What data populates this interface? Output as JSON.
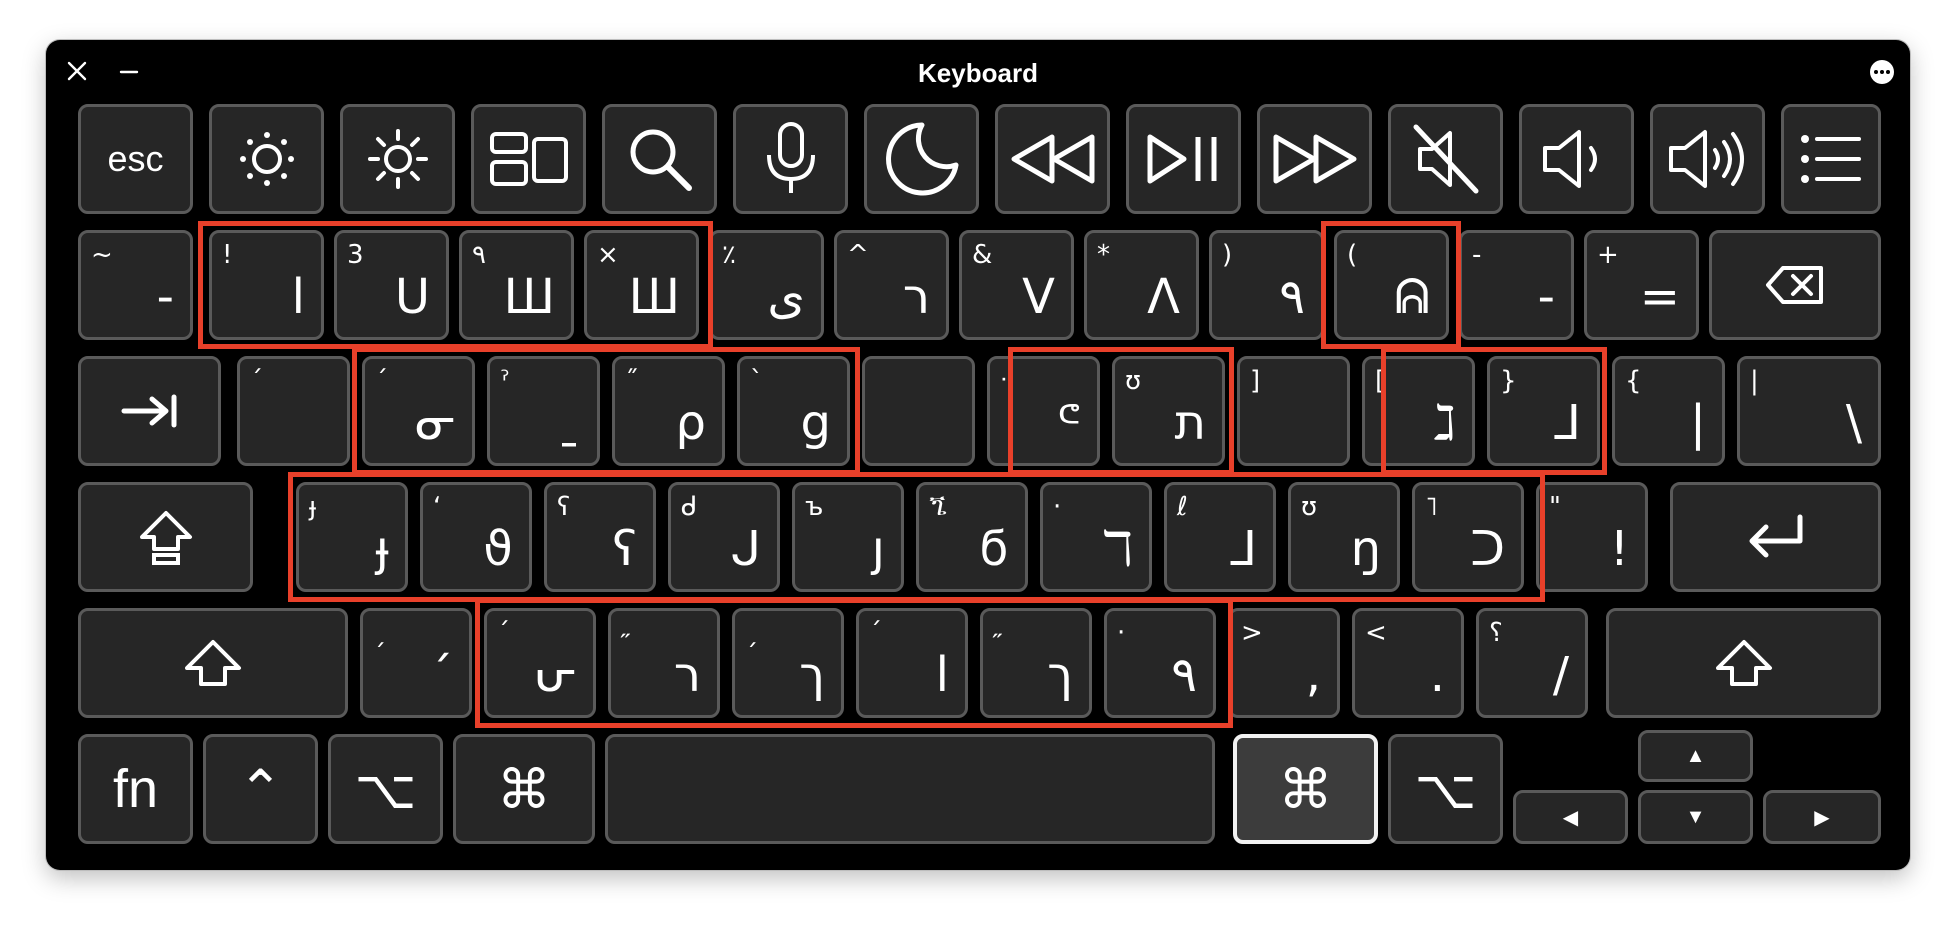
{
  "window": {
    "title": "Keyboard"
  },
  "function_row": [
    {
      "name": "esc-key",
      "label": "esc"
    },
    {
      "name": "brightness-down-key",
      "icon": "brightness-down-icon"
    },
    {
      "name": "brightness-up-key",
      "icon": "brightness-up-icon"
    },
    {
      "name": "mission-control-key",
      "icon": "mission-control-icon"
    },
    {
      "name": "spotlight-key",
      "icon": "search-icon"
    },
    {
      "name": "dictation-key",
      "icon": "microphone-icon"
    },
    {
      "name": "do-not-disturb-key",
      "icon": "moon-icon"
    },
    {
      "name": "rewind-key",
      "icon": "rewind-icon"
    },
    {
      "name": "play-pause-key",
      "icon": "play-pause-icon"
    },
    {
      "name": "fast-forward-key",
      "icon": "fast-forward-icon"
    },
    {
      "name": "mute-key",
      "icon": "mute-icon"
    },
    {
      "name": "volume-down-key",
      "icon": "volume-down-icon"
    },
    {
      "name": "volume-up-key",
      "icon": "volume-up-icon"
    },
    {
      "name": "menu-key",
      "icon": "list-icon"
    }
  ],
  "row1": [
    {
      "shift": "~",
      "main": "-"
    },
    {
      "shift": "!",
      "main": "ا"
    },
    {
      "shift": "3",
      "main": "U"
    },
    {
      "shift": "٩",
      "main": "Ш"
    },
    {
      "shift": "×",
      "main": "Ш"
    },
    {
      "shift": "٪",
      "main": "ى"
    },
    {
      "shift": "^",
      "main": "ר"
    },
    {
      "shift": "&",
      "main": "V"
    },
    {
      "shift": "*",
      "main": "Λ"
    },
    {
      "shift": ")",
      "main": "٩"
    },
    {
      "shift": "(",
      "main": "ᕱ"
    },
    {
      "shift": "-",
      "main": "-"
    },
    {
      "shift": "+",
      "main": "="
    }
  ],
  "row2": [
    {
      "shift": "ˊ",
      "main": ""
    },
    {
      "shift": "ˊ",
      "main": "ᓂ"
    },
    {
      "shift": "ˀ",
      "main": "ˍ"
    },
    {
      "shift": "˝",
      "main": "ρ"
    },
    {
      "shift": "ˋ",
      "main": "g"
    },
    {
      "shift": "",
      "main": ""
    },
    {
      "shift": "ᐧ",
      "main": "ᕪ"
    },
    {
      "shift": "ʊ",
      "main": "ת"
    },
    {
      "shift": "]",
      "main": ""
    },
    {
      "shift": "[",
      "main": "ℷ"
    },
    {
      "shift": "}",
      "main": "⅃"
    },
    {
      "shift": "{",
      "main": "|"
    },
    {
      "shift": "|",
      "main": "\\"
    }
  ],
  "row3": [
    {
      "shift": "ɟ",
      "main": "ɟ"
    },
    {
      "shift": "ʻ",
      "main": "ϑ"
    },
    {
      "shift": "ʕ",
      "main": "ʕ"
    },
    {
      "shift": "ᑯ",
      "main": "ᒍ"
    },
    {
      "shift": "ъ",
      "main": "ȷ"
    },
    {
      "shift": "ጜ",
      "main": "ϭ"
    },
    {
      "shift": "·",
      "main": "ℸ"
    },
    {
      "shift": "ℓ",
      "main": "ᒧ"
    },
    {
      "shift": "ʊ",
      "main": "ŋ"
    },
    {
      "shift": "˥",
      "main": "ᑐ"
    },
    {
      "shift": "\"",
      "main": "!"
    }
  ],
  "row4": [
    {
      "shift": "ˏ",
      "main": "ˊ"
    },
    {
      "shift": "ˊ",
      "main": "ᕂ"
    },
    {
      "shift": "˶",
      "main": "ר"
    },
    {
      "shift": "ˏ",
      "main": "ך"
    },
    {
      "shift": "ˊ",
      "main": "ا"
    },
    {
      "shift": "˶",
      "main": "ך"
    },
    {
      "shift": "·",
      "main": "٩"
    },
    {
      "shift": ">",
      "main": ","
    },
    {
      "shift": "<",
      "main": "."
    },
    {
      "shift": "؟",
      "main": "/"
    }
  ],
  "modifiers": {
    "fn": "fn",
    "control": "⌃",
    "option": "⌥",
    "command": "⌘"
  },
  "arrows": {
    "up": "▲",
    "left": "◀",
    "down": "▼",
    "right": "▶"
  },
  "highlight_color": "#e8402a"
}
